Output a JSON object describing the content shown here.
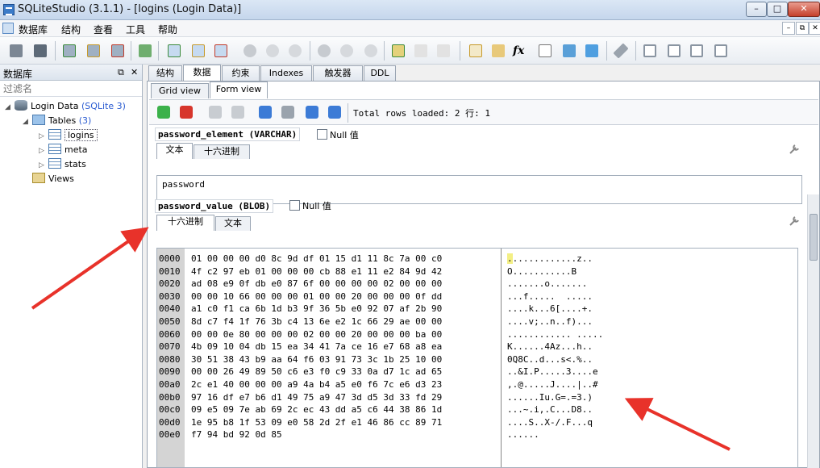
{
  "window": {
    "title": "SQLiteStudio (3.1.1) - [logins (Login Data)]",
    "min": "–",
    "max": "□",
    "close": "✕"
  },
  "menu": [
    "数据库",
    "结构",
    "查看",
    "工具",
    "帮助"
  ],
  "mdi": {
    "min": "–",
    "restore": "⧉",
    "close": "✕"
  },
  "toolbar_icons": [
    "connect-icon",
    "disconnect-icon",
    "add-db-icon",
    "edit-db-icon",
    "remove-db-icon",
    "refresh-icon",
    "create-table-icon",
    "edit-table-icon",
    "drop-table-icon",
    "add-index-icon",
    "edit-index-icon",
    "drop-index-icon",
    "add-trigger-icon",
    "edit-trigger-icon",
    "drop-trigger-icon",
    "add-view-icon",
    "edit-view-icon",
    "drop-view-icon",
    "sql-editor-icon",
    "query-history-icon",
    "functions-icon",
    "collations-icon",
    "extensions-icon",
    "config-icon",
    "settings-icon",
    "tile-icon",
    "tile-horizontal-icon",
    "tile-vertical-icon",
    "cascade-icon"
  ],
  "functions_glyph": "fx",
  "left_panel": {
    "title": "数据库",
    "filter_placeholder": "过滤名",
    "tree": {
      "db_name": "Login Data",
      "db_type": "(SQLite 3)",
      "tables_label": "Tables",
      "tables_count": "(3)",
      "tables": [
        "logins",
        "meta",
        "stats"
      ],
      "views_label": "Views"
    }
  },
  "tabs": [
    "结构",
    "数据",
    "约束",
    "Indexes",
    "触发器",
    "DDL"
  ],
  "active_tab": "数据",
  "subtabs": [
    "Grid view",
    "Form view"
  ],
  "active_subtab": "Form view",
  "form": {
    "total_rows": "Total rows loaded: 2",
    "row_label": "行: 1",
    "field1": {
      "name": "password_element",
      "type": "(VARCHAR)",
      "null_label": "Null 值",
      "tabs": [
        "文本",
        "十六进制"
      ],
      "value": "password"
    },
    "field2": {
      "name": "password_value",
      "type": "(BLOB)",
      "null_label": "Null 值",
      "tabs": [
        "十六进制",
        "文本"
      ]
    }
  },
  "hex": {
    "offsets": [
      "0000",
      "0010",
      "0020",
      "0030",
      "0040",
      "0050",
      "0060",
      "0070",
      "0080",
      "0090",
      "00a0",
      "00b0",
      "00c0",
      "00d0",
      "00e0"
    ],
    "bytes": [
      "01 00 00 00 d0 8c 9d df 01 15 d1 11 8c 7a 00 c0",
      "4f c2 97 eb 01 00 00 00 cb 88 e1 11 e2 84 9d 42",
      "ad 08 e9 0f db e0 87 6f 00 00 00 00 02 00 00 00",
      "00 00 10 66 00 00 00 01 00 00 20 00 00 00 0f dd",
      "a1 c0 f1 ca 6b 1d b3 9f 36 5b e0 92 07 af 2b 90",
      "8d c7 f4 1f 76 3b c4 13 6e e2 1c 66 29 ae 00 00",
      "00 00 0e 80 00 00 00 02 00 00 20 00 00 00 ba 00",
      "4b 09 10 04 db 15 ea 34 41 7a ce 16 e7 68 a8 ea",
      "30 51 38 43 b9 aa 64 f6 03 91 73 3c 1b 25 10 00",
      "00 00 26 49 89 50 c6 e3 f0 c9 33 0a d7 1c ad 65",
      "2c e1 40 00 00 00 a9 4a b4 a5 e0 f6 7c e6 d3 23",
      "97 16 df e7 b6 d1 49 75 a9 47 3d d5 3d 33 fd 29",
      "09 e5 09 7e ab 69 2c ec 43 dd a5 c6 44 38 86 1d",
      "1e 95 b8 1f 53 09 e0 58 2d 2f e1 46 86 cc 89 71",
      "f7 94 bd 92 0d 85"
    ],
    "ascii": [
      ".............z..",
      "O...........B",
      ".......o.......",
      "...f.....  .....",
      "....k...6[....+.",
      "....v;..n..f)...",
      "............ .....",
      "K......4Az...h..",
      "0Q8C..d...s<.%..",
      "..&I.P.....3....e",
      ",.@.....J....|..#",
      "......Iu.G=.=3.)",
      "...~.i,.C...D8..",
      "....S..X-/.F...q",
      "......"
    ]
  }
}
